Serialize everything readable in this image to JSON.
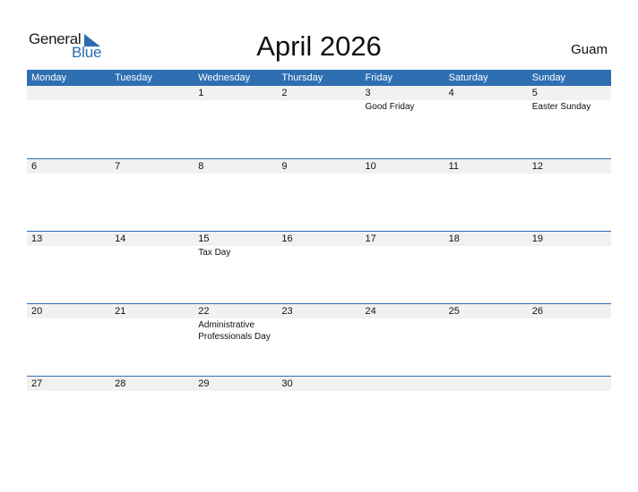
{
  "logo": {
    "general": "General",
    "blue": "Blue"
  },
  "header": {
    "title": "April 2026",
    "country": "Guam"
  },
  "colors": {
    "accent": "#2e6fb2",
    "row_band": "#f1f1f1"
  },
  "weekdays": [
    "Monday",
    "Tuesday",
    "Wednesday",
    "Thursday",
    "Friday",
    "Saturday",
    "Sunday"
  ],
  "weeks": [
    [
      {
        "day": ""
      },
      {
        "day": ""
      },
      {
        "day": "1"
      },
      {
        "day": "2"
      },
      {
        "day": "3",
        "event": "Good Friday"
      },
      {
        "day": "4"
      },
      {
        "day": "5",
        "event": "Easter Sunday"
      }
    ],
    [
      {
        "day": "6"
      },
      {
        "day": "7"
      },
      {
        "day": "8"
      },
      {
        "day": "9"
      },
      {
        "day": "10"
      },
      {
        "day": "11"
      },
      {
        "day": "12"
      }
    ],
    [
      {
        "day": "13"
      },
      {
        "day": "14"
      },
      {
        "day": "15",
        "event": "Tax Day"
      },
      {
        "day": "16"
      },
      {
        "day": "17"
      },
      {
        "day": "18"
      },
      {
        "day": "19"
      }
    ],
    [
      {
        "day": "20"
      },
      {
        "day": "21"
      },
      {
        "day": "22",
        "event": "Administrative Professionals Day"
      },
      {
        "day": "23"
      },
      {
        "day": "24"
      },
      {
        "day": "25"
      },
      {
        "day": "26"
      }
    ],
    [
      {
        "day": "27"
      },
      {
        "day": "28"
      },
      {
        "day": "29"
      },
      {
        "day": "30"
      },
      {
        "day": ""
      },
      {
        "day": ""
      },
      {
        "day": ""
      }
    ]
  ]
}
